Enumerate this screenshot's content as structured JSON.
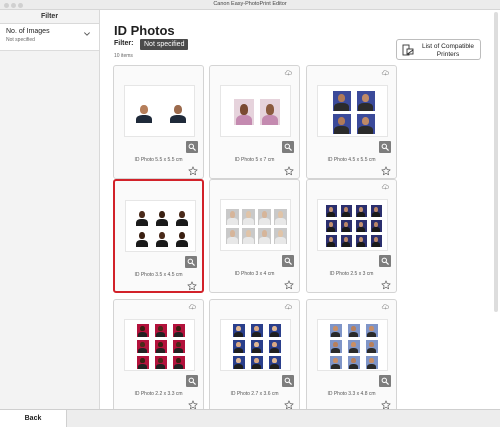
{
  "window": {
    "title": "Canon Easy-PhotoPrint Editor"
  },
  "sidebar": {
    "heading": "Filter",
    "filter": {
      "label": "No. of Images",
      "value": "Not specified"
    }
  },
  "main": {
    "title": "ID Photos",
    "filter_label": "Filter:",
    "filter_value": "Not specified",
    "count": "10 items",
    "compat_button": "List of Compatible Printers"
  },
  "cards": [
    {
      "label": "ID Photo 5.5 x 5.5 cm",
      "selected": false,
      "cloud": false
    },
    {
      "label": "ID Photo 5 x 7 cm",
      "selected": false,
      "cloud": true
    },
    {
      "label": "ID Photo 4.5 x 5.5 cm",
      "selected": false,
      "cloud": true
    },
    {
      "label": "ID Photo 3.5 x 4.5 cm",
      "selected": true,
      "cloud": false
    },
    {
      "label": "ID Photo 3 x 4 cm",
      "selected": false,
      "cloud": false
    },
    {
      "label": "ID Photo 2.5 x 3 cm",
      "selected": false,
      "cloud": true
    },
    {
      "label": "ID Photo 2.2 x 3.3 cm",
      "selected": false,
      "cloud": true
    },
    {
      "label": "ID Photo 2.7 x 3.6 cm",
      "selected": false,
      "cloud": true
    },
    {
      "label": "ID Photo 3.3 x 4.8 cm",
      "selected": false,
      "cloud": true
    }
  ],
  "colors": {
    "selected_border": "#d2222a",
    "badge_bg": "#4b4b4b",
    "zoom_bg": "#7d7d7d"
  },
  "icons": {
    "filter_chevron": "chevron-down-icon",
    "compat_printer": "printer-list-icon",
    "zoom": "magnifier-icon",
    "favorite": "star-icon",
    "download": "cloud-download-icon"
  },
  "footer": {
    "back": "Back"
  }
}
